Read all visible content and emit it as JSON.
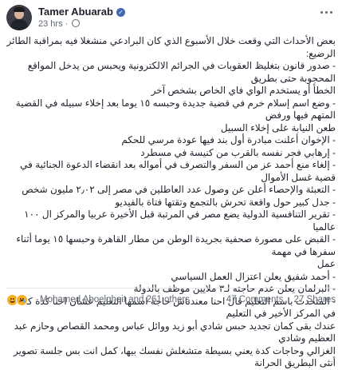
{
  "post": {
    "author": "Tamer Abuarab",
    "time": "23 hrs",
    "text_lines": [
      "بعض الأحداث التي وقعت خلال الأسبوع الذي كان البرادعي منشغلا فيه بمراقبة الطائر الرضيع:",
      "- صدور قانون بتغليظ العقوبات في الجرائم الالكترونية ويحبس من يدخل المواقع المحجوبة حتى بطريق",
      "الخطأ أو يستخدم الواي فاي الخاص بشخص آخر",
      "- وضع اسم إسلام خرم في قضية جديدة وحبسه ١٥ يوما بعد إخلاء سبيله في القضية المتهم فيها ورفض",
      "طعن النيابة على إخلاء السبيل",
      "- الإخوان أعلنت مبادرة أول بند فيها عودة مرسي للحكم",
      "- إرهابي فجر نفسه بالقرب من كنيسة في مسطرد",
      "- إلغاء منع أحمد عز من السفر والتصرف في أمواله بعد انقضاء الدعوة الجنائية في قضية غسل الأموال",
      "- التعبئة والإحصاء أعلن عن وصول عدد العاطلين في مصر إلى ٢٫٠٢ مليون شخص",
      "- جدل كبير حول واقعة تحرش بالتجمع وتقتها فتاة بالفيديو",
      "- تقرير التنافسية الدولية يضع مصر في المرتبة قبل الأخيرة عربيا والمركز ال ١٠٠ عالميا",
      "- القبض على مصورة صحفية بجريدة الوطن من مطار القاهرة وحبسها ١٥ يوما أثناء سفرها في مهمة",
      "عمل",
      "- أحمد شفيق يعلن اعتزال العمل السياسي",
      "- البرلمان يعلن عدم حاجته لـ٣ ملايين موظف بالدولة",
      "- المتحدث باسم التعليم قال احنا معندناش حاجة اسمها التعليم عشان احنا كدة كدة في المركز الأخير في التعليم",
      "عندك بقى كمان تجديد حبس شادي أبو زيد ووائل عباس ومحمد القصاص وحازم عبد العظيم وشادي",
      "الغزالي وحاجات كدة يعني بسيطة متشغلش نفسك بيها، كمل انت بس جلسة تصوير أنثى البطريق الحرانة"
    ]
  },
  "reactions": {
    "icons": [
      "haha-reaction-icon",
      "sad-reaction-icon"
    ],
    "summary": "Mohamed Aboelgheit and 261 others"
  },
  "counts": {
    "comments": "47 Comments",
    "shares": "27 Shares"
  }
}
